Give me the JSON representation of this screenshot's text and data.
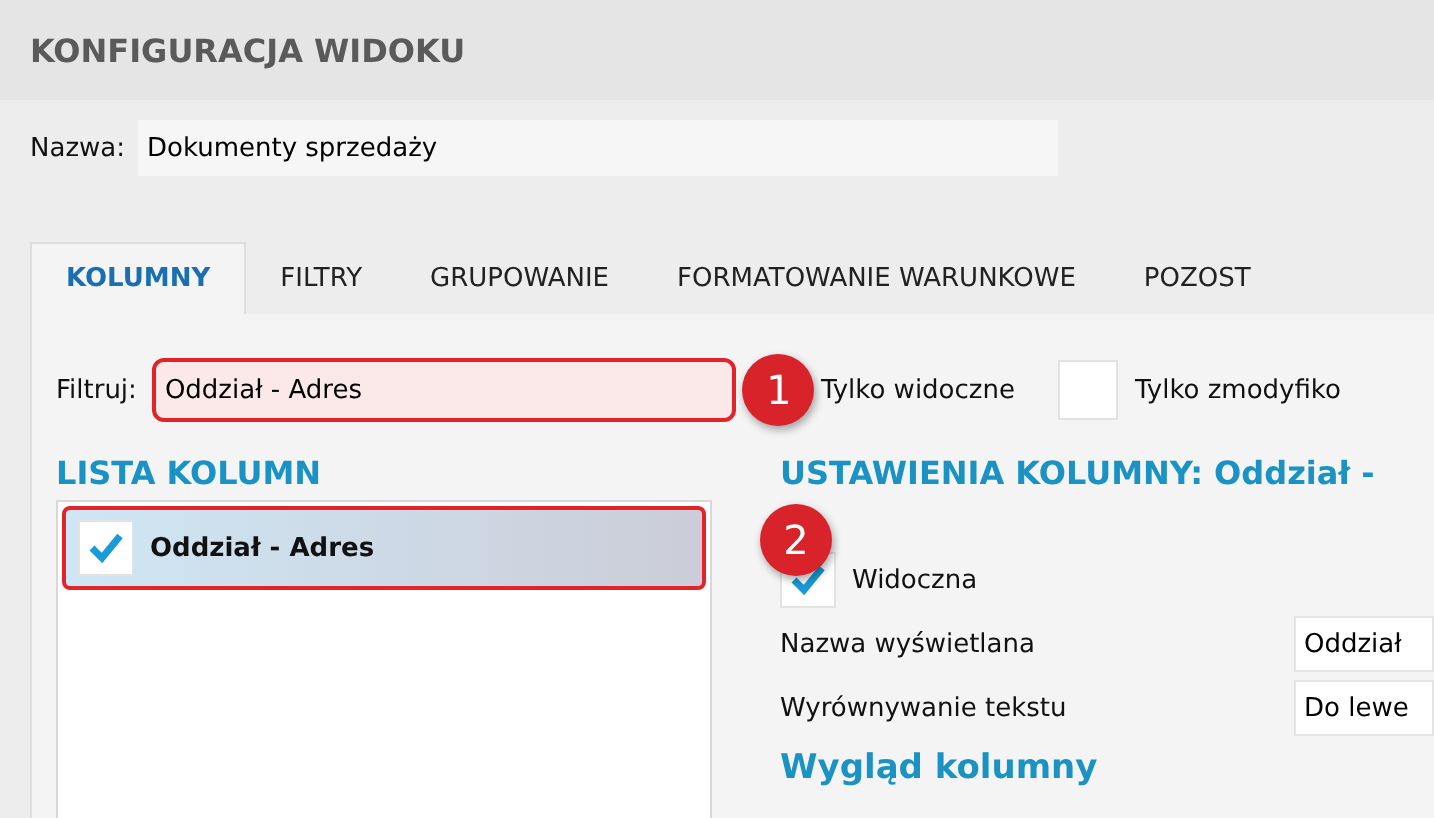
{
  "window": {
    "title": "KONFIGURACJA WIDOKU"
  },
  "name_field": {
    "label": "Nazwa:",
    "value": "Dokumenty sprzedaży"
  },
  "tabs": [
    {
      "label": "KOLUMNY",
      "selected": true
    },
    {
      "label": "FILTRY",
      "selected": false
    },
    {
      "label": "GRUPOWANIE",
      "selected": false
    },
    {
      "label": "FORMATOWANIE WARUNKOWE",
      "selected": false
    },
    {
      "label": "POZOST",
      "selected": false
    }
  ],
  "filter": {
    "label": "Filtruj:",
    "value": "Oddział - Adres",
    "only_visible_label": "Tylko widoczne",
    "only_modified": {
      "label": "Tylko zmodyfiko",
      "checked": false
    }
  },
  "callouts": [
    "1",
    "2"
  ],
  "column_list": {
    "title": "LISTA KOLUMN",
    "items": [
      {
        "label": "Oddział - Adres",
        "checked": true,
        "selected": true
      }
    ]
  },
  "column_settings": {
    "title": "USTAWIENIA KOLUMNY: Oddział -",
    "visible": {
      "label": "Widoczna",
      "checked": true
    },
    "fields": [
      {
        "label": "Nazwa wyświetlana",
        "value": "Oddział"
      },
      {
        "label": "Wyrównywanie tekstu",
        "value": "Do lewe"
      }
    ],
    "section_title": "Wygląd kolumny"
  }
}
